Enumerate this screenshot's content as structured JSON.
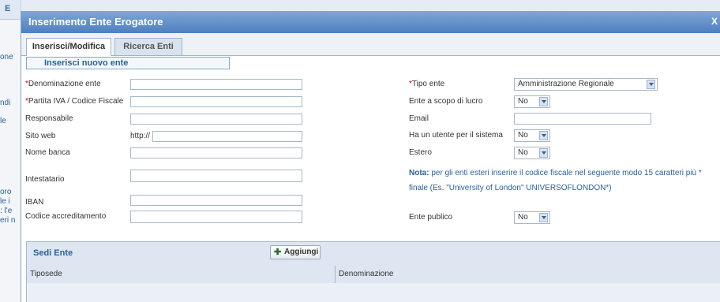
{
  "background": {
    "left_fragments": [
      "E",
      "one",
      "ndi",
      "le",
      "oro",
      "le i",
      ": l'e",
      "eri n"
    ]
  },
  "window": {
    "title": "Inserimento Ente Erogatore",
    "close_label": "X"
  },
  "tabs": [
    {
      "label": "Inserisci/Modifica",
      "active": true
    },
    {
      "label": "Ricerca Enti",
      "active": false
    }
  ],
  "section_title": "Inserisci nuovo ente",
  "left_form": {
    "denominazione": {
      "label": "Denominazione ente",
      "required_mark": "*",
      "value": ""
    },
    "partita_iva": {
      "label": "Partita IVA / Codice Fiscale",
      "required_mark": "*",
      "value": ""
    },
    "responsabile": {
      "label": "Responsabile",
      "value": ""
    },
    "sito_web": {
      "label": "Sito web",
      "prefix": "http://",
      "value": ""
    },
    "nome_banca": {
      "label": "Nome banca",
      "value": ""
    },
    "intestatario": {
      "label": "Intestatario",
      "value": ""
    },
    "iban": {
      "label": "IBAN",
      "value": ""
    },
    "codice_accreditamento": {
      "label": "Codice accreditamento",
      "value": ""
    }
  },
  "right_form": {
    "tipo_ente": {
      "label": "Tipo ente",
      "required_mark": "*",
      "value": "Amministrazione Regionale"
    },
    "scopo_lucro": {
      "label": "Ente a scopo di lucro",
      "value": "No"
    },
    "email": {
      "label": "Email",
      "value": ""
    },
    "utente_sistema": {
      "label": "Ha un utente per il sistema",
      "value": "No"
    },
    "estero": {
      "label": "Estero",
      "value": "No"
    },
    "nota": {
      "label": "Nota:",
      "text": "per gli enti esteri inserire il codice fiscale nel seguente modo 15 caratteri più * finale (Es. \"University of London\" UNIVERSOFLONDON*)"
    },
    "ente_pubblico": {
      "label": "Ente publico",
      "value": "No"
    }
  },
  "sedi_grid": {
    "title": "Sedi Ente",
    "add_button": "Aggiungi",
    "columns": [
      "Tiposede",
      "Denominazione"
    ]
  },
  "colors": {
    "title_bar": "#5a87c6",
    "accent": "#2a5f9c",
    "required": "#cc0000"
  }
}
